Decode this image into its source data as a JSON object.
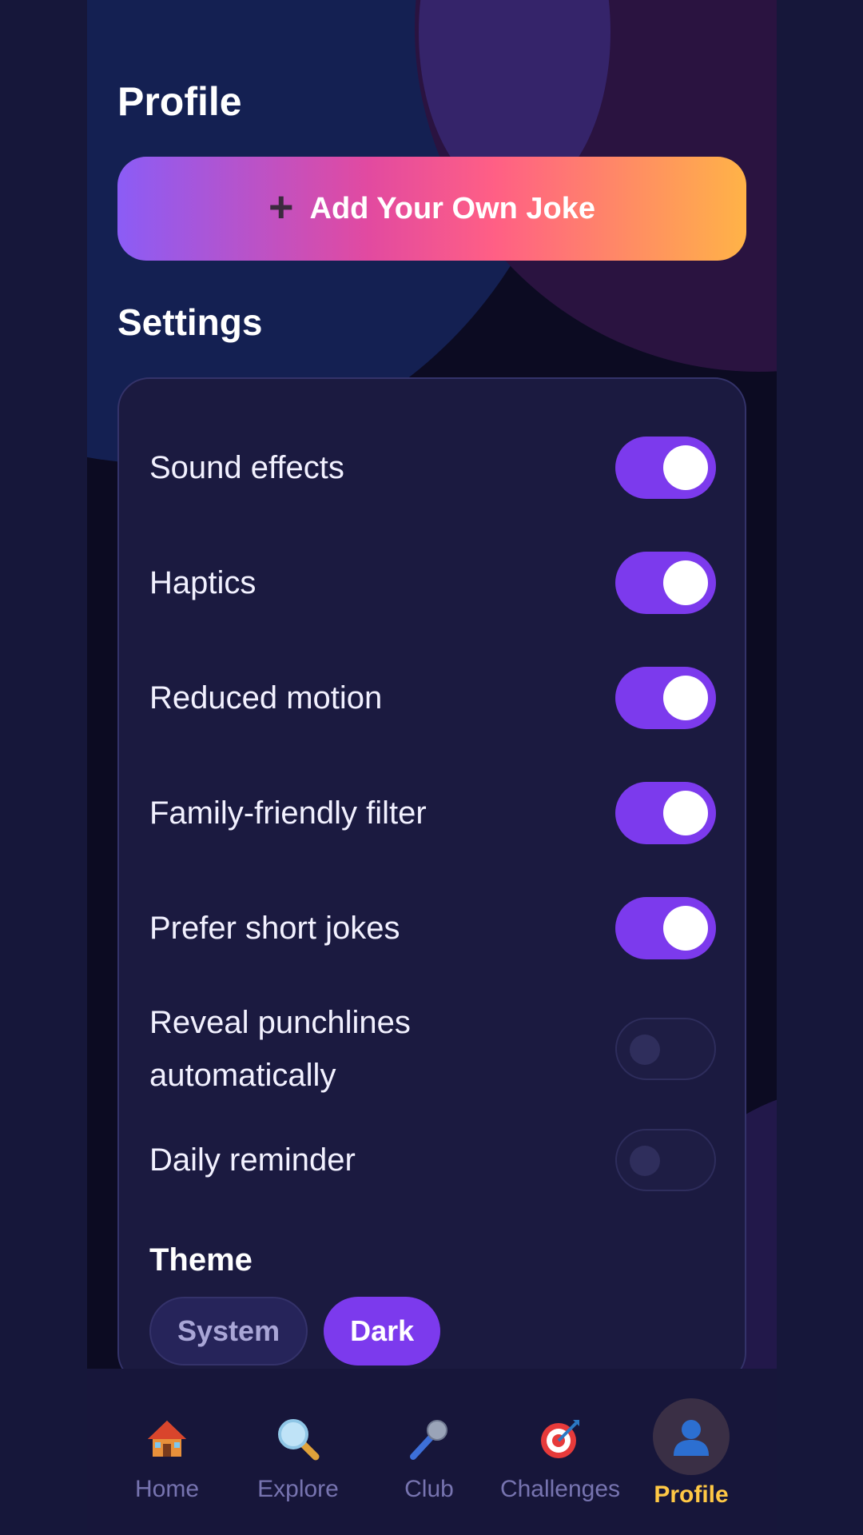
{
  "header": {
    "title": "Profile"
  },
  "add_joke": {
    "icon": "plus-icon",
    "label": "Add Your Own Joke"
  },
  "settings": {
    "title": "Settings",
    "items": [
      {
        "label": "Sound effects",
        "on": true
      },
      {
        "label": "Haptics",
        "on": true
      },
      {
        "label": "Reduced motion",
        "on": true
      },
      {
        "label": "Family-friendly filter",
        "on": true
      },
      {
        "label": "Prefer short jokes",
        "on": true
      },
      {
        "label": "Reveal punchlines automatically",
        "on": false
      },
      {
        "label": "Daily reminder",
        "on": false
      }
    ],
    "theme": {
      "title": "Theme",
      "options": [
        "System",
        "Dark"
      ],
      "selected": "Dark"
    }
  },
  "tabs": [
    {
      "label": "Home",
      "icon": "house-icon"
    },
    {
      "label": "Explore",
      "icon": "magnifier-icon"
    },
    {
      "label": "Club",
      "icon": "microphone-icon"
    },
    {
      "label": "Challenges",
      "icon": "target-icon"
    },
    {
      "label": "Profile",
      "icon": "user-icon",
      "active": true
    }
  ],
  "colors": {
    "accent": "#7c3aed",
    "active_tab": "#ffc845",
    "background": "#0c0b22"
  }
}
